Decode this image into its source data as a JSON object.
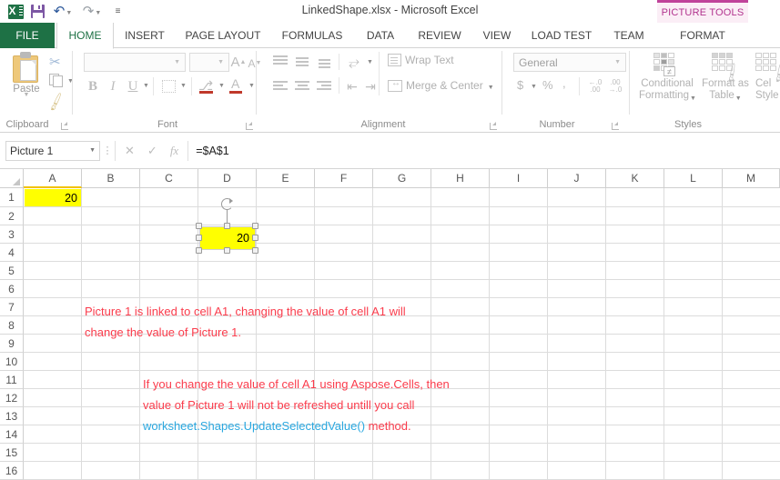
{
  "window": {
    "title": "LinkedShape.xlsx - Microsoft Excel",
    "app_logo": "excel-logo-icon"
  },
  "quick_access": {
    "items": [
      {
        "name": "save-icon",
        "label": "Save"
      },
      {
        "name": "undo-icon",
        "label": "Undo",
        "glyph": "↶"
      },
      {
        "name": "redo-icon",
        "label": "Redo",
        "glyph": "↷"
      },
      {
        "name": "customize-qat-icon",
        "label": "Customize Quick Access Toolbar",
        "glyph": "≡"
      }
    ],
    "caret": "▼"
  },
  "contextual": {
    "label": "PICTURE TOOLS",
    "accent_color": "#c0429a",
    "background_color": "#fbeef6"
  },
  "tabs": [
    {
      "label": "FILE",
      "active": false,
      "kind": "file"
    },
    {
      "label": "HOME",
      "active": true,
      "kind": "normal"
    },
    {
      "label": "INSERT",
      "active": false,
      "kind": "normal"
    },
    {
      "label": "PAGE LAYOUT",
      "active": false,
      "kind": "normal"
    },
    {
      "label": "FORMULAS",
      "active": false,
      "kind": "normal"
    },
    {
      "label": "DATA",
      "active": false,
      "kind": "normal"
    },
    {
      "label": "REVIEW",
      "active": false,
      "kind": "normal"
    },
    {
      "label": "VIEW",
      "active": false,
      "kind": "normal"
    },
    {
      "label": "LOAD TEST",
      "active": false,
      "kind": "normal"
    },
    {
      "label": "TEAM",
      "active": false,
      "kind": "normal"
    },
    {
      "label": "FORMAT",
      "active": false,
      "kind": "contextual"
    }
  ],
  "ribbon": {
    "groups": [
      {
        "label": "Clipboard"
      },
      {
        "label": "Font"
      },
      {
        "label": "Alignment"
      },
      {
        "label": "Number"
      },
      {
        "label": "Styles"
      }
    ],
    "clipboard": {
      "paste_label": "Paste",
      "cut_label": "Cut",
      "copy_label": "Copy",
      "format_painter_label": "Format Painter"
    },
    "font": {
      "font_name_value": "",
      "font_size_value": "",
      "grow_font_label": "A",
      "shrink_font_label": "A",
      "bold_label": "B",
      "italic_label": "I",
      "underline_label": "U",
      "borders_label": "Borders",
      "fill_color_label": "Fill Color",
      "font_color_label": "A"
    },
    "alignment": {
      "wrap_text_label": "Wrap Text",
      "merge_center_label": "Merge & Center",
      "orientation_label": "Orientation",
      "decrease_indent_label": "Decrease Indent",
      "increase_indent_label": "Increase Indent"
    },
    "number": {
      "format_value": "General",
      "currency_label": "$",
      "percent_label": "%",
      "comma_label": ",",
      "increase_decimal_label": ".00",
      "decrease_decimal_label": ".00"
    },
    "styles": {
      "conditional_formatting_line1": "Conditional",
      "conditional_formatting_line2": "Formatting",
      "format_as_table_line1": "Format as",
      "format_as_table_line2": "Table",
      "cell_styles_line1": "Cel",
      "cell_styles_line2": "Style"
    }
  },
  "formula_bar": {
    "name_box_value": "Picture 1",
    "cancel_label": "✕",
    "enter_label": "✓",
    "fx_label": "fx",
    "formula_value": "=$A$1"
  },
  "grid": {
    "columns": [
      "A",
      "B",
      "C",
      "D",
      "E",
      "F",
      "G",
      "H",
      "I",
      "J",
      "K",
      "L",
      "M"
    ],
    "rows": [
      "1",
      "2",
      "3",
      "4",
      "5",
      "6",
      "7",
      "8",
      "9",
      "10",
      "11",
      "12",
      "13",
      "14",
      "15",
      "16"
    ],
    "selected_column": "A",
    "cells": [
      {
        "ref": "A1",
        "value": "20",
        "fill": "#ffff00",
        "align": "right"
      }
    ]
  },
  "shape": {
    "name": "Picture 1",
    "value": "20",
    "fill": "#ffff00",
    "anchor_cell": "D3",
    "selected": true
  },
  "annotations": [
    {
      "id": "note-1",
      "color": "#fa3c4c",
      "lines": [
        [
          {
            "text": "Picture 1 is linked to cell A1, changing the value of cell A1 will",
            "style": "red"
          }
        ],
        [
          {
            "text": "change the value of Picture 1.",
            "style": "red"
          }
        ]
      ]
    },
    {
      "id": "note-2",
      "color": "#fa3c4c",
      "lines": [
        [
          {
            "text": "If you change the value of cell A1 using Aspose.Cells, then",
            "style": "red"
          }
        ],
        [
          {
            "text": "value of Picture 1 will not be refreshed untill you call",
            "style": "red"
          }
        ],
        [
          {
            "text": "worksheet.Shapes.UpdateSelectedValue()",
            "style": "cyan"
          },
          {
            "text": " method.",
            "style": "red"
          }
        ]
      ]
    }
  ]
}
